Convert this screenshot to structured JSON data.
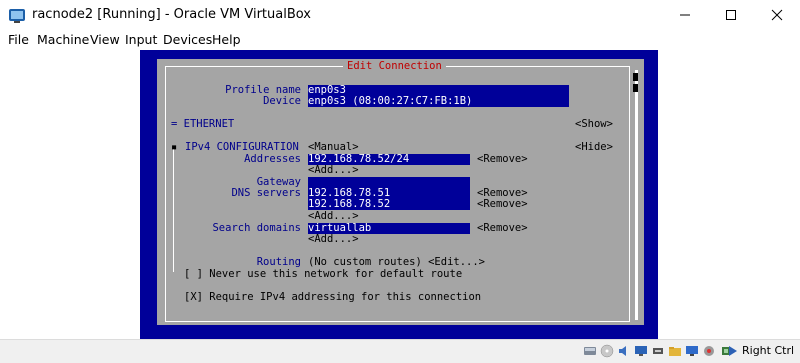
{
  "window": {
    "title": "racnode2 [Running] - Oracle VM VirtualBox",
    "icons": [
      "virtualbox-icon",
      "minimize-icon",
      "maximize-icon",
      "close-icon"
    ]
  },
  "menu": [
    "File",
    "Machine",
    "View",
    "Input",
    "Devices",
    "Help"
  ],
  "tui": {
    "title": "Edit Connection",
    "profile_name_label": "Profile name",
    "profile_name_value": "enp0s3",
    "device_label": "Device",
    "device_value": "enp0s3 (08:00:27:C7:FB:1B)",
    "ethernet_label": "= ETHERNET",
    "show_button": "<Show>",
    "ipv4_label": "IPv4 CONFIGURATION",
    "ipv4_mode": "<Manual>",
    "hide_button": "<Hide>",
    "addresses_label": "Addresses",
    "address_1": "192.168.78.52/24",
    "remove_label": "<Remove>",
    "add_label": "<Add...>",
    "gateway_label": "Gateway",
    "gateway_value": "",
    "dns_label": "DNS servers",
    "dns_1": "192.168.78.51",
    "dns_2": "192.168.78.52",
    "search_label": "Search domains",
    "search_1": "virtuallab",
    "routing_label": "Routing",
    "routing_value": "(No custom routes) <Edit...>",
    "never_default": "[ ] Never use this network for default route",
    "require_ipv4": "[X] Require IPv4 addressing for this connection"
  },
  "statusbar": {
    "host_key": "Right Ctrl",
    "icons": [
      "hard-disk-icon",
      "optical-drive-icon",
      "audio-icon",
      "network-icon",
      "usb-icon",
      "shared-folder-icon",
      "display-icon",
      "video-capture-icon",
      "cpu-icon",
      "mouse-integration-icon",
      "host-key-arrow-icon"
    ]
  },
  "colors": {
    "vm_blue": "#000099",
    "tui_gray": "#a5a5a5",
    "label_blue": "#00008b",
    "title_red": "#c00000"
  }
}
